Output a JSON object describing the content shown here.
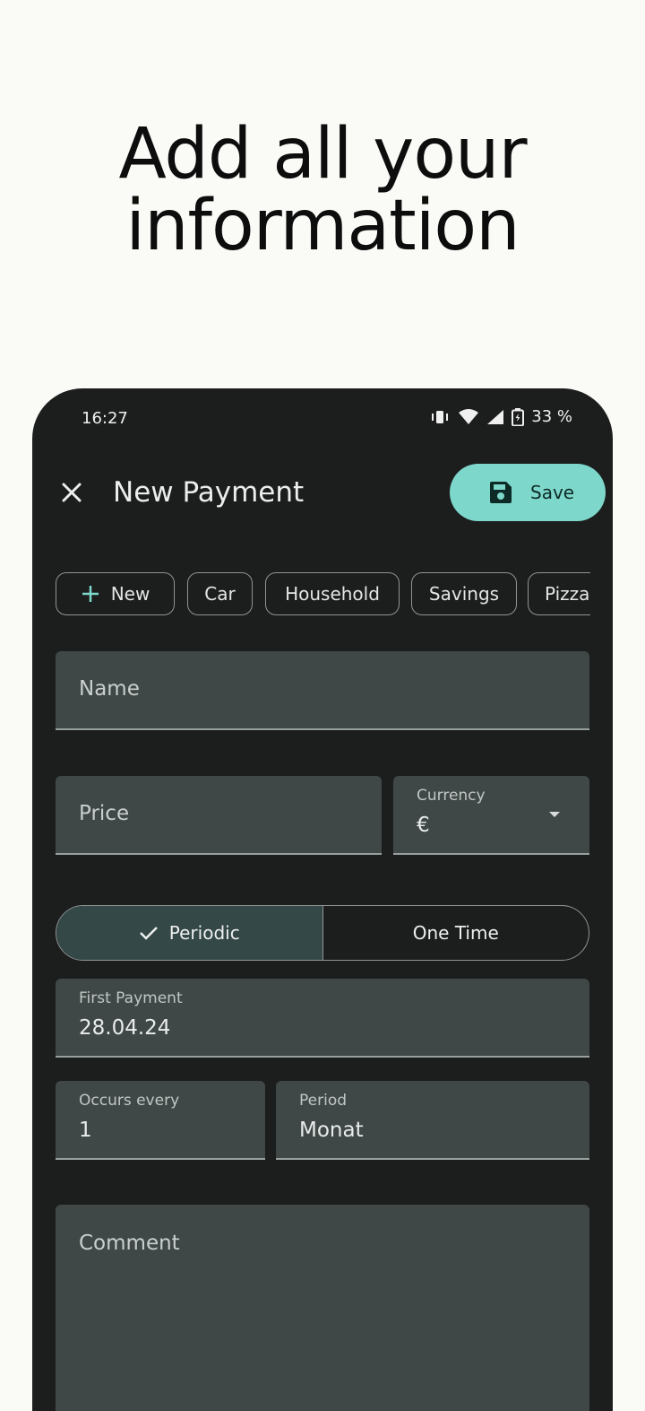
{
  "headline": {
    "line1": "Add all your",
    "line2": "information"
  },
  "status_bar": {
    "time": "16:27",
    "battery": "33 %"
  },
  "appbar": {
    "title": "New Payment",
    "save_label": "Save"
  },
  "categories": [
    "New",
    "Car",
    "Household",
    "Savings",
    "Pizza"
  ],
  "form": {
    "name_placeholder": "Name",
    "price_placeholder": "Price",
    "currency_label": "Currency",
    "currency_value": "€",
    "payment_type": {
      "options": [
        "Periodic",
        "One Time"
      ],
      "selected": "Periodic"
    },
    "first_payment_label": "First Payment",
    "first_payment_value": "28.04.24",
    "occurs_every_label": "Occurs every",
    "occurs_every_value": "1",
    "period_label": "Period",
    "period_value": "Monat",
    "comment_placeholder": "Comment"
  },
  "colors": {
    "accent": "#7dd8cb",
    "surface": "#1c1d1d",
    "field": "#404847",
    "selected_segment": "#344847"
  },
  "icons": [
    "close-icon",
    "save-icon",
    "plus-icon",
    "check-icon",
    "dropdown-arrow-icon",
    "vibrate-icon",
    "wifi-icon",
    "signal-icon",
    "battery-icon"
  ]
}
